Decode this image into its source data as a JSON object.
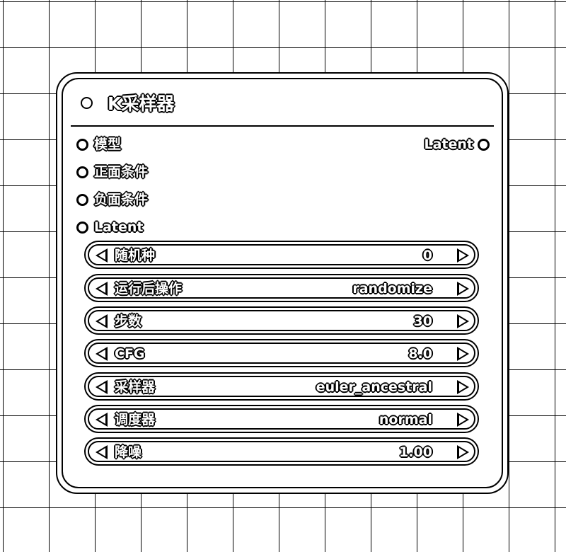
{
  "node": {
    "title": "K采样器",
    "inputs": [
      "模型",
      "正面条件",
      "负面条件",
      "Latent"
    ],
    "outputs": [
      "Latent"
    ],
    "widgets": [
      {
        "label": "随机种",
        "value": "0"
      },
      {
        "label": "运行后操作",
        "value": "randomize"
      },
      {
        "label": "步数",
        "value": "30"
      },
      {
        "label": "CFG",
        "value": "8.0"
      },
      {
        "label": "采样器",
        "value": "euler_ancestral"
      },
      {
        "label": "调度器",
        "value": "normal"
      },
      {
        "label": "降噪",
        "value": "1.00"
      }
    ]
  },
  "icons": {
    "widget_decrement": "left-triangle-arrow-icon",
    "widget_increment": "right-triangle-arrow-icon",
    "slot": "circle-slot-icon",
    "collapse": "circle-collapse-icon"
  },
  "colors": {
    "background": "#ffffff",
    "ink": "#000000"
  }
}
